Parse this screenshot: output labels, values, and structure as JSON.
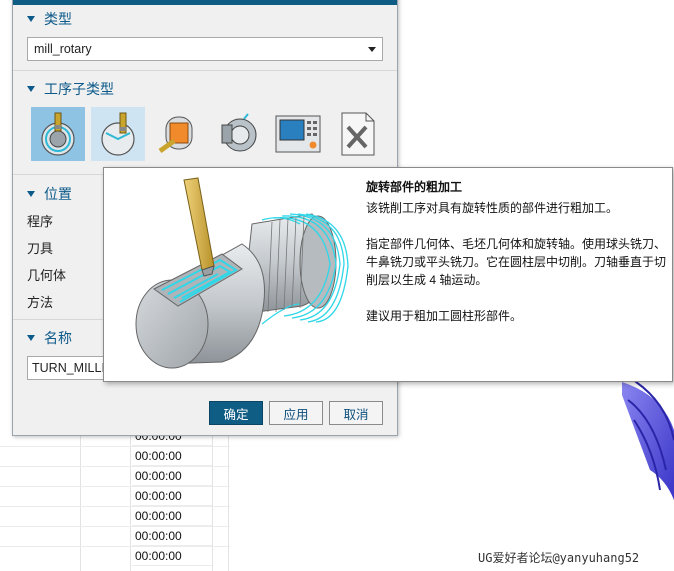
{
  "dialog": {
    "sections": {
      "type": {
        "label": "类型",
        "value": "mill_rotary"
      },
      "subtype": {
        "label": "工序子类型"
      },
      "position": {
        "label": "位置",
        "fields": [
          {
            "label": "程序"
          },
          {
            "label": "刀具"
          },
          {
            "label": "几何体"
          },
          {
            "label": "方法"
          }
        ]
      },
      "name": {
        "label": "名称",
        "value": "TURN_MILLI"
      }
    },
    "subtype_icons": [
      {
        "name": "rotary-roughing-icon",
        "state": "selected"
      },
      {
        "name": "rotary-floor-icon",
        "state": "hover"
      },
      {
        "name": "rotary-finish-icon",
        "state": "normal"
      },
      {
        "name": "rotary-contour-icon",
        "state": "normal"
      },
      {
        "name": "mill-user-icon",
        "state": "normal"
      },
      {
        "name": "mill-control-icon",
        "state": "normal"
      }
    ],
    "buttons": {
      "ok": "确定",
      "apply": "应用",
      "cancel": "取消"
    }
  },
  "tooltip": {
    "title": "旋转部件的粗加工",
    "p1": "该铣削工序对具有旋转性质的部件进行粗加工。",
    "p2": "指定部件几何体、毛坯几何体和旋转轴。使用球头铣刀、牛鼻铣刀或平头铣刀。它在圆柱层中切削。刀轴垂直于切削层以生成 4 轴运动。",
    "p3": "建议用于粗加工圆柱形部件。"
  },
  "background_table": {
    "times": [
      "00:00:00",
      "00:00:00",
      "00:00:00",
      "00:00:00",
      "00:00:00",
      "00:00:00",
      "00:00:00"
    ]
  },
  "watermark": "UG爱好者论坛@yanyuhang52",
  "colors": {
    "accent": "#0f5c85",
    "section_text": "#0c5a8a",
    "selected_tile": "#8fc3e3",
    "toolpath": "#2fd7e8"
  }
}
